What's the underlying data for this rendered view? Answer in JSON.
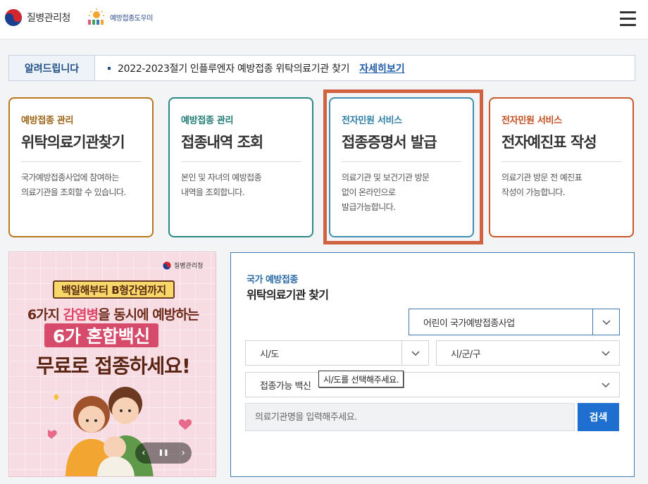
{
  "header": {
    "org_name": "질병관리청",
    "vax_helper_name": "예방접종도우미",
    "menu_icon": "hamburger-icon"
  },
  "notice": {
    "label": "알려드립니다",
    "text": "2022-2023절기 인플루엔자 예방접종 위탁의료기관 찾기",
    "link": "자세히보기"
  },
  "cards": [
    {
      "category": "예방접종 관리",
      "title": "위탁의료기관찾기",
      "desc": "국가예방접종사업에 참여하는\n의료기관을 조회할 수 있습니다."
    },
    {
      "category": "예방접종 관리",
      "title": "접종내역 조회",
      "desc": "본인 및 자녀의 예방접종\n내역을 조회합니다."
    },
    {
      "category": "전자민원 서비스",
      "title": "접종증명서 발급",
      "desc": "의료기관 및 보건기관 방문\n없이 온라인으로\n발급가능합니다."
    },
    {
      "category": "전자민원 서비스",
      "title": "전자예진표 작성",
      "desc": "의료기관 방문 전 예진표\n작성이 가능합니다."
    }
  ],
  "banner": {
    "org": "질병관리청",
    "subtitle": "백일해부터 B형간염까지",
    "line1_pre": "6가지 ",
    "line1_em": "감염병",
    "line1_post": "을 동시에 예방하는",
    "line2": "6가 혼합백신",
    "line3": "무료로 접종하세요!",
    "prev": "‹",
    "pause": "❚❚",
    "next": "›"
  },
  "search": {
    "subtitle": "국가 예방접종",
    "title": "위탁의료기관 찾기",
    "program_select": "어린이 국가예방접종사업",
    "sido_select": "시/도",
    "sigungu_select": "시/군/구",
    "vaccine_select": "접종가능 백신",
    "tooltip": "시/도를 선택해주세요.",
    "name_placeholder": "의료기관명을 입력해주세요.",
    "search_button": "검색"
  },
  "colors": {
    "card1": "#b9761d",
    "card2": "#2a8a83",
    "card3": "#3f8fb3",
    "card4": "#c9582b",
    "highlight": "#d0623f",
    "search_button": "#1e6fd0"
  }
}
